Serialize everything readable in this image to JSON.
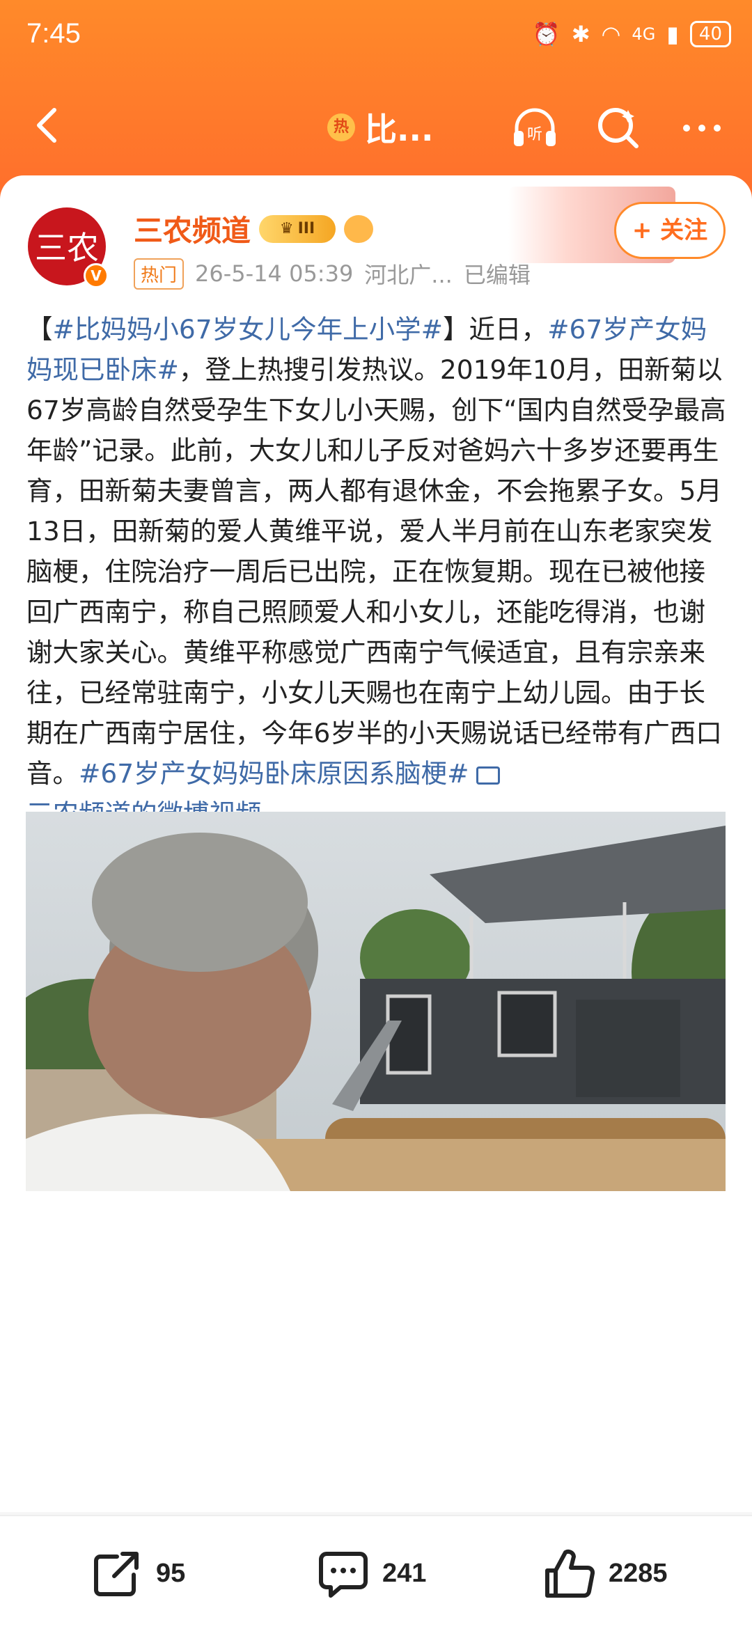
{
  "status": {
    "time": "7:45",
    "network": "4G",
    "battery": "40"
  },
  "nav": {
    "hot_badge": "热",
    "title": "比...",
    "listen": "听"
  },
  "post": {
    "author": "三农频道",
    "avatar_text": "三农",
    "vip_level": "III",
    "hot_tag": "热门",
    "datetime": "26-5-14 05:39",
    "location": "河北广...",
    "edited": "已编辑",
    "follow_label": "+ 关注",
    "content_parts": [
      {
        "text": "【",
        "type": "text"
      },
      {
        "text": "#比妈妈小67岁女儿今年上小学#",
        "type": "tag"
      },
      {
        "text": "】近日，",
        "type": "text"
      },
      {
        "text": "#67岁产女妈妈现已卧床#",
        "type": "tag"
      },
      {
        "text": "，登上热搜引发热议。2019年10月，田新菊以67岁高龄自然受孕生下女儿小天赐，创下“国内自然受孕最高年龄”记录。此前，大女儿和儿子反对爸妈六十多岁还要再生育，田新菊夫妻曾言，两人都有退休金，不会拖累子女。5月13日，田新菊的爱人黄维平说，爱人半月前在山东老家突发脑梗，住院治疗一周后已出院，正在恢复期。现在已被他接回广西南宁，称自己照顾爱人和小女儿，还能吃得消，也谢谢大家关心。黄维平称感觉广西南宁气候适宜，且有宗亲来往，已经常驻南宁，小女儿天赐也在南宁上幼儿园。由于长期在广西南宁居住，今年6岁半的小天赐说话已经带有广西口音。",
        "type": "text"
      },
      {
        "text": "#67岁产女妈妈卧床原因系脑梗#",
        "type": "tag"
      }
    ],
    "video_link": "三农频道的微博视频"
  },
  "actions": {
    "repost_count": "95",
    "comment_count": "241",
    "like_count": "2285"
  },
  "colors": {
    "header_orange": "#ff7a2a",
    "author_orange": "#f05a18",
    "link_blue": "#3f6aa7"
  }
}
